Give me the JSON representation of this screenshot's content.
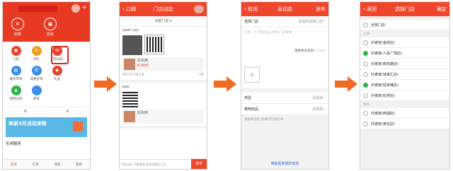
{
  "phone1": {
    "header_btns": [
      "收款",
      "结余"
    ],
    "grid": [
      {
        "label": "门店",
        "icon": "store-icon",
        "color": "#e8452c"
      },
      {
        "label": "评价",
        "icon": "star-icon",
        "color": "#f0a020"
      },
      {
        "label": "门店动态",
        "icon": "news-icon",
        "color": "#e8452c"
      },
      {
        "label": "服务市场",
        "icon": "market-icon",
        "color": "#3d8ee8"
      },
      {
        "label": "消费买单",
        "icon": "bill-icon",
        "color": "#3d8ee8"
      },
      {
        "label": "礼品",
        "icon": "gift-icon",
        "color": "#e8452c"
      },
      {
        "label": "经营分析",
        "icon": "chart-icon",
        "color": "#2fb24a"
      },
      {
        "label": "更多",
        "icon": "more-icon",
        "color": "#3d8ee8"
      }
    ],
    "stats": [
      "0",
      "0"
    ],
    "banner_title": "商家3月活动来啦",
    "banner_sub": "",
    "section": "实用服务",
    "tabs": [
      "首页",
      "订单",
      "消息",
      "我的"
    ]
  },
  "phone2": {
    "back": "口碑",
    "title": "门店动态",
    "filter": "全部门店",
    "card1_name": "yeah xxx",
    "card1_prod": "好东西",
    "card1_price": "8.00元",
    "card1_date": "04-14 16:18",
    "card2_name": "pop",
    "card2_prod": "好东西",
    "input_hint": "您说,有人可能喜欢,快说到商品上去",
    "publish": "发布"
  },
  "phone3": {
    "back": "取消",
    "title": "发动态",
    "publish": "发布",
    "store_label": "选择门店",
    "store_hint": "请选择适用门店",
    "text_hint": "分享一下,你的新品,优惠,门店故事……",
    "count_hint": "0/200",
    "assist": "需要更多帮助?",
    "row1_label": "类型",
    "row1_value": "请选择",
    "row2_label": "推荐商品",
    "row2_value": "请选择",
    "note": "添加商品后,会展示在动态中",
    "help": "谁能看到我的动态"
  },
  "phone4": {
    "back": "返回",
    "title": "选择门店",
    "done": "确定",
    "all": "全部门店",
    "group1": "上海",
    "stores": [
      {
        "name": "外婆家(金桥店)",
        "on": false
      },
      {
        "name": "外婆家(人民广场店)",
        "on": true
      },
      {
        "name": "外婆家(南京路店)",
        "on": false
      },
      {
        "name": "外婆家(徐家汇店)",
        "on": false
      },
      {
        "name": "外婆家(陆家嘴店)",
        "on": true
      },
      {
        "name": "外婆家(虹桥店)",
        "on": false
      }
    ],
    "group2": "杭州",
    "stores2": [
      {
        "name": "外婆家(西湖店)",
        "on": false
      },
      {
        "name": "外婆家(黄龙店)",
        "on": false
      }
    ]
  },
  "colors": {
    "accent": "#f0452a",
    "arrow": "#f26b22",
    "check": "#2fb24a"
  }
}
